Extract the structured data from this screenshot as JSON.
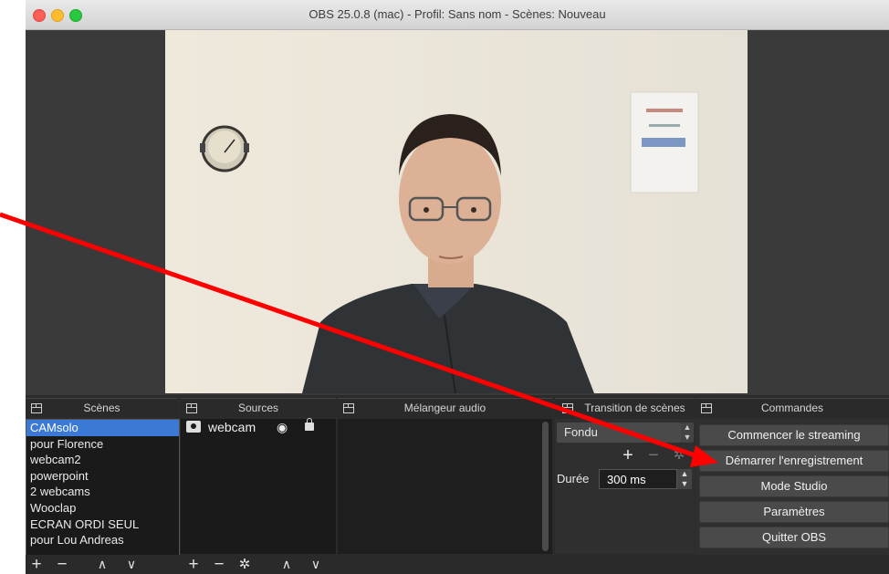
{
  "window": {
    "title": "OBS 25.0.8 (mac) - Profil: Sans nom - Scènes: Nouveau"
  },
  "docks": {
    "scenes": "Scènes",
    "sources": "Sources",
    "mixer": "Mélangeur audio",
    "transitions": "Transition de scènes",
    "commands": "Commandes"
  },
  "scenes": [
    {
      "label": "CAMsolo",
      "selected": true
    },
    {
      "label": "pour Florence"
    },
    {
      "label": "webcam2"
    },
    {
      "label": "powerpoint"
    },
    {
      "label": "2 webcams"
    },
    {
      "label": "Wooclap"
    },
    {
      "label": "ECRAN ORDI SEUL"
    },
    {
      "label": "pour Lou Andreas"
    }
  ],
  "sources": [
    {
      "label": "webcam",
      "visible": true,
      "locked": true
    }
  ],
  "transition": {
    "selected": "Fondu",
    "duration_label": "Durée",
    "duration_value": "300 ms"
  },
  "commands": {
    "start_streaming": "Commencer le streaming",
    "start_recording": "Démarrer l'enregistrement",
    "studio_mode": "Mode Studio",
    "settings": "Paramètres",
    "quit": "Quitter OBS"
  },
  "colors": {
    "selection": "#3b79d6",
    "arrow": "#ff0000",
    "panel_bg": "#2b2b2b"
  },
  "icons": [
    "close-icon",
    "minimize-icon",
    "zoom-icon",
    "dock-float-icon",
    "camera-icon",
    "eye-icon",
    "lock-icon",
    "plus-icon",
    "minus-icon",
    "up-icon",
    "down-icon",
    "gear-icon",
    "chevron-updown-icon"
  ]
}
